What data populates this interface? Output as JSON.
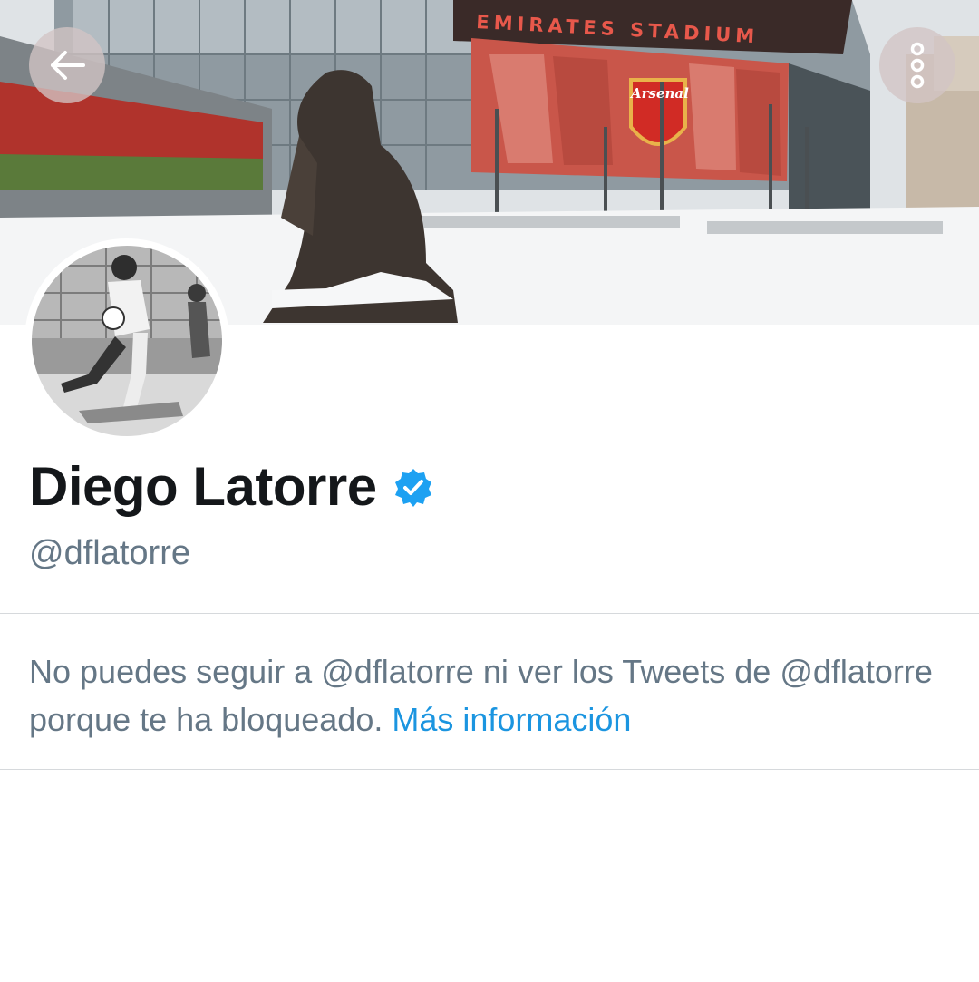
{
  "banner": {
    "sign_text": "EMIRATES STADIUM",
    "crest_text": "Arsenal"
  },
  "toolbar": {
    "back_icon": "arrow-left-icon",
    "more_icon": "more-vertical-icon"
  },
  "profile": {
    "display_name": "Diego Latorre",
    "handle": "@dflatorre",
    "verified_icon": "verified-badge-icon",
    "verified_color": "#1da1f2"
  },
  "blocked_notice": {
    "message": "No puedes seguir a @dflatorre ni ver los Tweets de @dflatorre porque te ha bloqueado.",
    "link_label": "Más información",
    "link_color": "#1b95e0"
  },
  "colors": {
    "text_primary": "#14171a",
    "text_secondary": "#657786",
    "divider": "#d6d9dc"
  }
}
